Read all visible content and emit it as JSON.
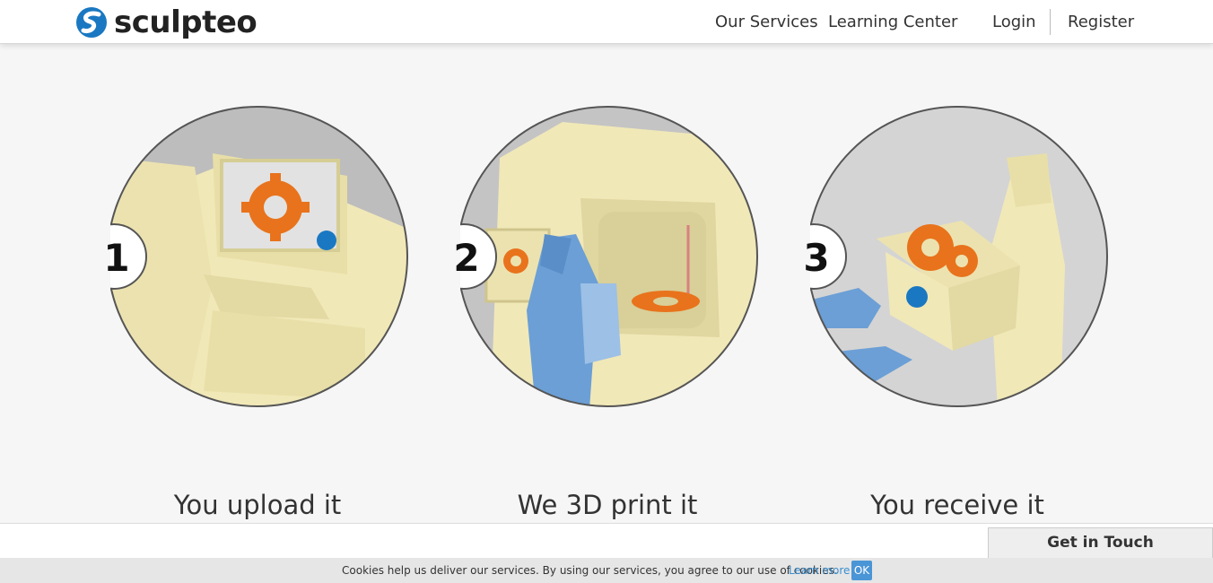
{
  "header": {
    "logo_text": "sculpteo",
    "nav": {
      "our_services": "Our Services",
      "learning_center": "Learning Center",
      "login": "Login",
      "register": "Register"
    }
  },
  "steps": [
    {
      "number": "1",
      "caption": "You upload it"
    },
    {
      "number": "2",
      "caption": "We 3D print it"
    },
    {
      "number": "3",
      "caption": "You receive it"
    }
  ],
  "contact": {
    "label": "Get in Touch"
  },
  "cookie_bar": {
    "text": "Cookies help us deliver our services. By using our services, you agree to our use of cookies.",
    "learn_more": "Learn more",
    "ok": "OK"
  },
  "colors": {
    "brand_blue": "#1a78c2",
    "accent_orange": "#e8731c",
    "figure_cream": "#f1e8b8",
    "figure_blue": "#6b9fd6"
  }
}
